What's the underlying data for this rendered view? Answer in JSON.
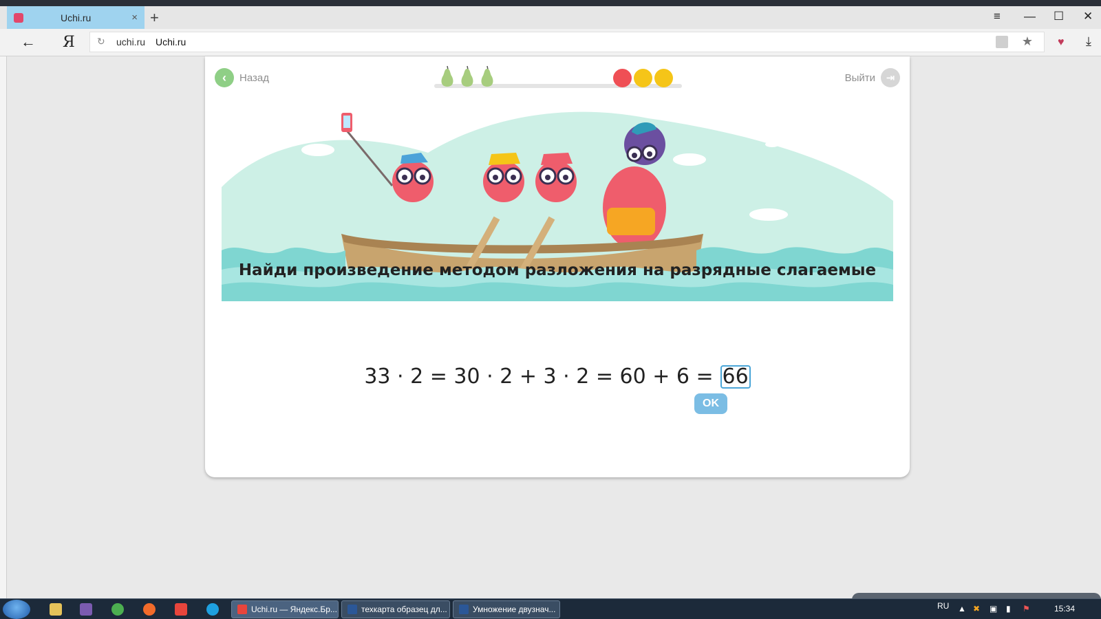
{
  "browser": {
    "tab": {
      "title": "Uchi.ru",
      "close": "×"
    },
    "new_tab": "+",
    "window_controls": {
      "menu": "≡",
      "minimize": "—",
      "maximize": "☐",
      "close": "✕"
    },
    "nav": {
      "back": "←",
      "yandex": "Я"
    },
    "address": {
      "domain": "uchi.ru",
      "page_title": "Uchi.ru"
    },
    "icons": {
      "reload": "reload-icon",
      "lock": "lock-icon",
      "star": "star-icon",
      "heart": "heart-icon",
      "download": "download-icon"
    }
  },
  "page": {
    "back_label": "Назад",
    "exit_label": "Выйти",
    "progress": {
      "pears": 3,
      "apples": 3
    },
    "task_title": "Найди произведение методом разложения на разрядные слагаемые",
    "equation": "33 · 2 = 30 · 2 + 3 · 2 = 60 + 6 =",
    "answer_value": "66",
    "ok_label": "OK"
  },
  "taskbar": {
    "items": [
      {
        "label": "Uchi.ru — Яндекс.Бр...",
        "icon": "yandex-browser-icon"
      },
      {
        "label": "техкарта образец дл...",
        "icon": "word-icon"
      },
      {
        "label": "Умножение двузнач...",
        "icon": "word-icon"
      }
    ],
    "lang": "RU",
    "clock": "15:34"
  },
  "colors": {
    "tab_active": "#9fd3ef",
    "accent_green": "#8fcf86",
    "answer_border": "#4aa6d8",
    "ok_button": "#7bbde4",
    "banner_bg": "#cdf0e6",
    "water": "#7fd6d1"
  }
}
